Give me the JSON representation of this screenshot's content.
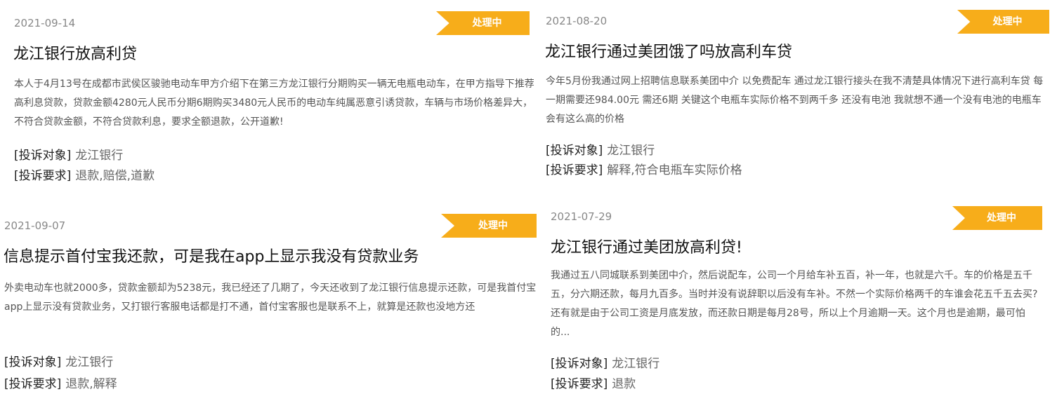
{
  "colors": {
    "badge": "#f7ad1a"
  },
  "labels": {
    "target": "[投诉对象]",
    "request": "[投诉要求]"
  },
  "cards": [
    {
      "date": "2021-09-14",
      "status": "处理中",
      "title": "龙江银行放高利贷",
      "desc": "本人于4月13号在成都市武侯区骏驰电动车甲方介绍下在第三方龙江银行分期购买一辆无电瓶电动车，在甲方指导下推荐高利息贷款，贷款金额4280元人民币分期6期购买3480元人民币的电动车纯属恶意引诱贷款，车辆与市场价格差异大，不符合贷款金额，不符合贷款利息，要求全额退款，公开道歉!",
      "target": "龙江银行",
      "request": "退款,赔偿,道歉"
    },
    {
      "date": "2021-08-20",
      "status": "处理中",
      "title": "龙江银行通过美团饿了吗放高利车贷",
      "desc": "今年5月份我通过网上招聘信息联系美团中介 以免费配车 通过龙江银行接头在我不清楚具体情况下进行高利车贷 每一期需要还984.00元 需还6期 关键这个电瓶车实际价格不到两千多 还没有电池 我就想不通一个没有电池的电瓶车会有这么高的价格",
      "target": "龙江银行",
      "request": "解释,符合电瓶车实际价格"
    },
    {
      "date": "2021-09-07",
      "status": "处理中",
      "title": "信息提示首付宝我还款，可是我在app上显示我没有贷款业务",
      "desc": "外卖电动车也就2000多，贷款金额却为5238元，我已经还了几期了，今天还收到了龙江银行信息提示还款，可是我首付宝app上显示没有贷款业务，又打银行客服电话都是打不通，首付宝客服也是联系不上，就算是还款也没地方还",
      "target": "龙江银行",
      "request": "退款,解释"
    },
    {
      "date": "2021-07-29",
      "status": "处理中",
      "title": "龙江银行通过美团放高利贷!",
      "desc": "我通过五八同城联系到美团中介，然后说配车，公司一个月给车补五百，补一年，也就是六千。车的价格是五千五，分六期还款，每月九百多。当时并没有说辞职以后没有车补。不然一个实际价格两千的车谁会花五千五去买? 还有就是由于公司工资是月底发放，而还款日期是每月28号，所以上个月逾期一天。这个月也是逾期，最可怕的...",
      "target": "龙江银行",
      "request": "退款"
    }
  ]
}
